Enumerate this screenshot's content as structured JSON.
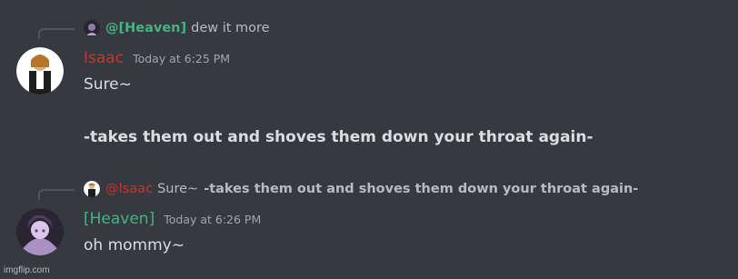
{
  "messages": [
    {
      "reply": {
        "mention": "@[Heaven]",
        "text": "dew it more"
      },
      "author": "Isaac",
      "timestamp": "Today at 6:25 PM",
      "lines": [
        "Sure~",
        "-takes them out and shoves them down your throat again-"
      ]
    },
    {
      "reply": {
        "mention": "@Isaac",
        "text_plain": "Sure~ ",
        "text_bold": "-takes them out and shoves them down your throat again-"
      },
      "author": "[Heaven]",
      "timestamp": "Today at 6:26 PM",
      "lines": [
        "oh mommy~"
      ]
    }
  ],
  "colors": {
    "background": "#36393f",
    "heaven_name": "#43b581",
    "isaac_name": "#c0392b",
    "text": "#dcddde",
    "timestamp": "#a3a6aa"
  },
  "icons": [
    "reply-spine",
    "heaven-avatar",
    "isaac-avatar"
  ],
  "watermark": "imgflip.com"
}
